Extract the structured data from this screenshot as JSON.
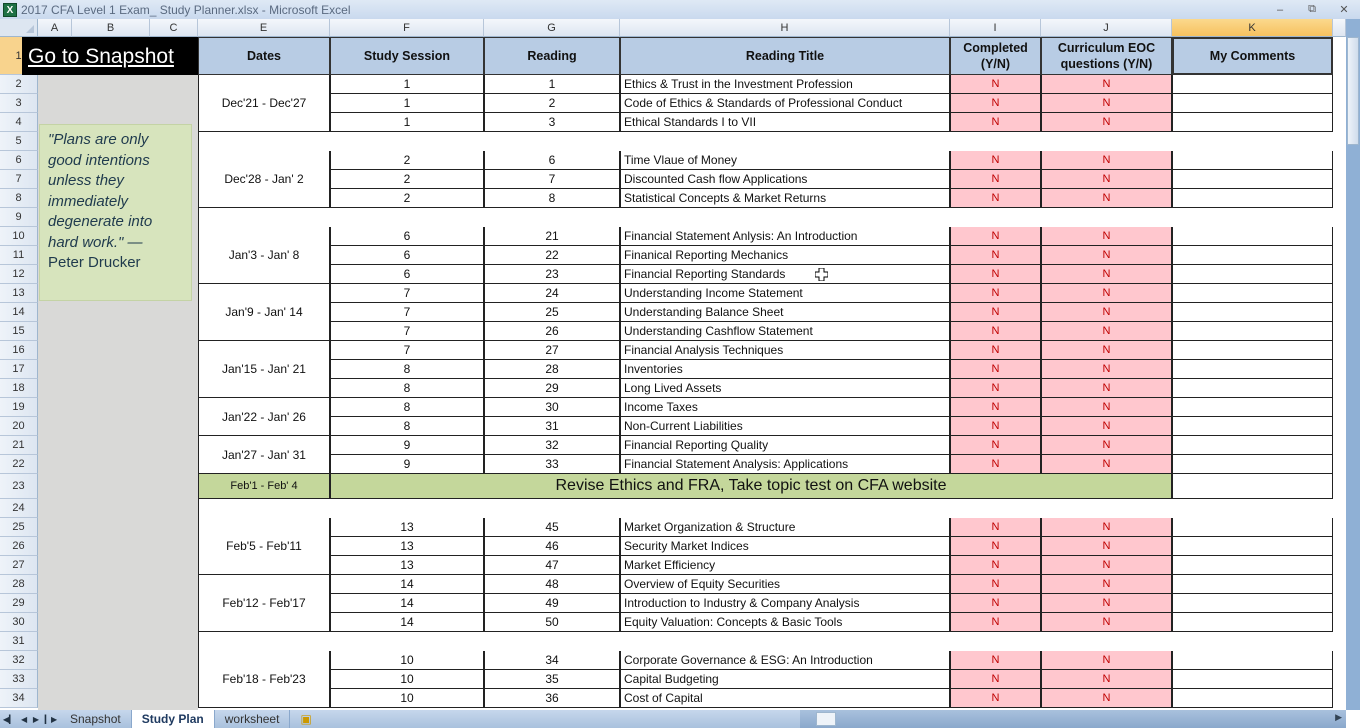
{
  "window": {
    "title": "2017 CFA Level 1 Exam_ Study Planner.xlsx - Microsoft Excel",
    "app_icon": "excel-icon",
    "controls": [
      "minimize",
      "restore",
      "close"
    ]
  },
  "columns": [
    "A",
    "B",
    "C",
    "E",
    "F",
    "G",
    "H",
    "I",
    "J",
    "K"
  ],
  "selected_column": "K",
  "snapshot_link": "Go to Snapshot",
  "quote": {
    "text": "\"Plans are only good intentions unless they immediately degenerate into hard work.\" —",
    "author": "Peter Drucker"
  },
  "headers": {
    "dates": "Dates",
    "study_session": "Study Session",
    "reading": "Reading",
    "reading_title": "Reading Title",
    "completed": "Completed (Y/N)",
    "eoc": "Curriculum EOC questions (Y/N)",
    "comments": "My Comments"
  },
  "rows": [
    {
      "row": 2,
      "session": "1",
      "reading": "1",
      "title": "Ethics & Trust in the Investment Profession",
      "completed": "N",
      "eoc": "N"
    },
    {
      "row": 3,
      "session": "1",
      "reading": "2",
      "title": "Code of Ethics & Standards of Professional Conduct",
      "completed": "N",
      "eoc": "N"
    },
    {
      "row": 4,
      "session": "1",
      "reading": "3",
      "title": "Ethical Standards I to VII",
      "completed": "N",
      "eoc": "N"
    },
    {
      "row": 5,
      "blank": true
    },
    {
      "row": 6,
      "session": "2",
      "reading": "6",
      "title": "Time Vlaue of Money",
      "completed": "N",
      "eoc": "N"
    },
    {
      "row": 7,
      "session": "2",
      "reading": "7",
      "title": "Discounted Cash flow Applications",
      "completed": "N",
      "eoc": "N"
    },
    {
      "row": 8,
      "session": "2",
      "reading": "8",
      "title": "Statistical Concepts & Market Returns",
      "completed": "N",
      "eoc": "N"
    },
    {
      "row": 9,
      "blank": true
    },
    {
      "row": 10,
      "session": "6",
      "reading": "21",
      "title": "Financial Statement Anlysis: An Introduction",
      "completed": "N",
      "eoc": "N"
    },
    {
      "row": 11,
      "session": "6",
      "reading": "22",
      "title": "Finanical Reporting Mechanics",
      "completed": "N",
      "eoc": "N"
    },
    {
      "row": 12,
      "session": "6",
      "reading": "23",
      "title": "Financial Reporting Standards",
      "completed": "N",
      "eoc": "N"
    },
    {
      "row": 13,
      "session": "7",
      "reading": "24",
      "title": "Understanding Income Statement",
      "completed": "N",
      "eoc": "N"
    },
    {
      "row": 14,
      "session": "7",
      "reading": "25",
      "title": "Understanding Balance Sheet",
      "completed": "N",
      "eoc": "N"
    },
    {
      "row": 15,
      "session": "7",
      "reading": "26",
      "title": "Understanding Cashflow Statement",
      "completed": "N",
      "eoc": "N"
    },
    {
      "row": 16,
      "session": "7",
      "reading": "27",
      "title": "Financial Analysis Techniques",
      "completed": "N",
      "eoc": "N"
    },
    {
      "row": 17,
      "session": "8",
      "reading": "28",
      "title": "Inventories",
      "completed": "N",
      "eoc": "N"
    },
    {
      "row": 18,
      "session": "8",
      "reading": "29",
      "title": "Long Lived Assets",
      "completed": "N",
      "eoc": "N"
    },
    {
      "row": 19,
      "session": "8",
      "reading": "30",
      "title": "Income Taxes",
      "completed": "N",
      "eoc": "N"
    },
    {
      "row": 20,
      "session": "8",
      "reading": "31",
      "title": "Non-Current Liabilities",
      "completed": "N",
      "eoc": "N"
    },
    {
      "row": 21,
      "session": "9",
      "reading": "32",
      "title": "Financial Reporting Quality",
      "completed": "N",
      "eoc": "N"
    },
    {
      "row": 22,
      "session": "9",
      "reading": "33",
      "title": "Financial Statement Analysis: Applications",
      "completed": "N",
      "eoc": "N"
    },
    {
      "row": 23,
      "revision": true
    },
    {
      "row": 24,
      "blank": true
    },
    {
      "row": 25,
      "session": "13",
      "reading": "45",
      "title": "Market Organization & Structure",
      "completed": "N",
      "eoc": "N"
    },
    {
      "row": 26,
      "session": "13",
      "reading": "46",
      "title": "Security Market Indices",
      "completed": "N",
      "eoc": "N"
    },
    {
      "row": 27,
      "session": "13",
      "reading": "47",
      "title": "Market Efficiency",
      "completed": "N",
      "eoc": "N"
    },
    {
      "row": 28,
      "session": "14",
      "reading": "48",
      "title": "Overview of Equity Securities",
      "completed": "N",
      "eoc": "N"
    },
    {
      "row": 29,
      "session": "14",
      "reading": "49",
      "title": "Introduction to Industry & Company Analysis",
      "completed": "N",
      "eoc": "N"
    },
    {
      "row": 30,
      "session": "14",
      "reading": "50",
      "title": "Equity Valuation: Concepts & Basic Tools",
      "completed": "N",
      "eoc": "N"
    },
    {
      "row": 31,
      "blank": true
    },
    {
      "row": 32,
      "session": "10",
      "reading": "34",
      "title": "Corporate Governance & ESG: An Introduction",
      "completed": "N",
      "eoc": "N"
    },
    {
      "row": 33,
      "session": "10",
      "reading": "35",
      "title": "Capital Budgeting",
      "completed": "N",
      "eoc": "N"
    },
    {
      "row": 34,
      "session": "10",
      "reading": "36",
      "title": "Cost of Capital",
      "completed": "N",
      "eoc": "N"
    }
  ],
  "date_groups": [
    {
      "label": "Dec'21 - Dec'27",
      "from": 2,
      "to": 4
    },
    {
      "label": "Dec'28 - Jan' 2",
      "from": 6,
      "to": 8
    },
    {
      "label": "Jan'3 - Jan' 8",
      "from": 10,
      "to": 12
    },
    {
      "label": "Jan'9 - Jan' 14",
      "from": 13,
      "to": 15
    },
    {
      "label": "Jan'15 - Jan' 21",
      "from": 16,
      "to": 18
    },
    {
      "label": "Jan'22 - Jan' 26",
      "from": 19,
      "to": 20
    },
    {
      "label": "Jan'27 - Jan' 31",
      "from": 21,
      "to": 22
    },
    {
      "label": "Feb'5 - Feb'11",
      "from": 25,
      "to": 27
    },
    {
      "label": "Feb'12 - Feb'17",
      "from": 28,
      "to": 30
    },
    {
      "label": "Feb'18 - Feb'23",
      "from": 32,
      "to": 34
    }
  ],
  "revision": {
    "dates": "Feb'1 - Feb' 4",
    "text": "Revise Ethics and FRA, Take topic test on CFA website"
  },
  "sheet_tabs": [
    {
      "label": "Snapshot",
      "active": false
    },
    {
      "label": "Study Plan",
      "active": true
    },
    {
      "label": "worksheet",
      "active": false
    }
  ],
  "colors": {
    "header_blue": "#b8cce4",
    "pink_fill": "#ffc7ce",
    "pink_text": "#c00000",
    "revision_green": "#c4d79b",
    "quote_green": "#d7e4bd"
  }
}
